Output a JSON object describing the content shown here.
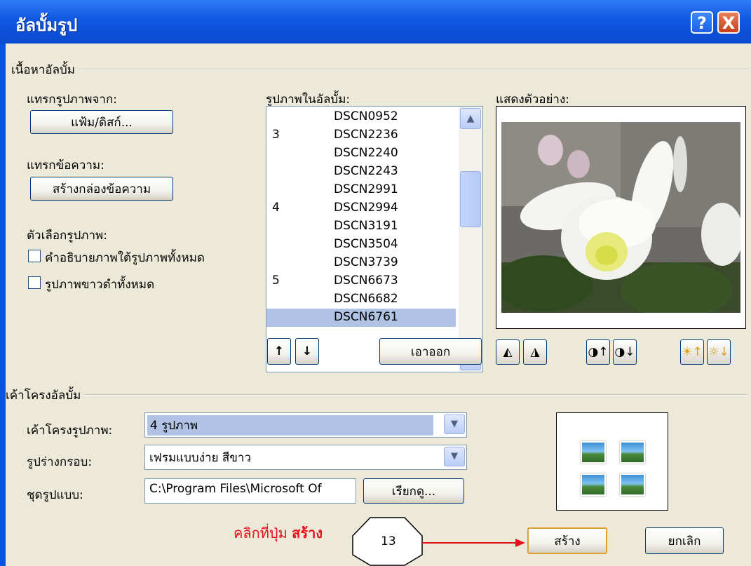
{
  "window": {
    "title": "อัลบั้มรูป",
    "help_label": "?",
    "close_label": "X"
  },
  "content_group": {
    "label": "เนื้อหาอัลบั้ม",
    "insert_from_label": "แทรกรูปภาพจาก:",
    "file_disk_button": "แฟ้ม/ดิสก์...",
    "insert_text_label": "แทรกข้อความ:",
    "new_textbox_button": "สร้างกล่องข้อความ",
    "picture_options_label": "ตัวเลือกรูปภาพ:",
    "caption_checkbox": "คำอธิบายภาพใต้รูปภาพทั้งหมด",
    "bw_checkbox": "รูปภาพขาวดำทั้งหมด"
  },
  "pictures_list": {
    "label": "รูปภาพในอัลบั้ม:",
    "items": [
      {
        "num": "",
        "name": "DSCN0952"
      },
      {
        "num": "3",
        "name": "DSCN2236"
      },
      {
        "num": "",
        "name": "DSCN2240"
      },
      {
        "num": "",
        "name": "DSCN2243"
      },
      {
        "num": "",
        "name": "DSCN2991"
      },
      {
        "num": "4",
        "name": "DSCN2994"
      },
      {
        "num": "",
        "name": "DSCN3191"
      },
      {
        "num": "",
        "name": "DSCN3504"
      },
      {
        "num": "",
        "name": "DSCN3739"
      },
      {
        "num": "5",
        "name": "DSCN6673"
      },
      {
        "num": "",
        "name": "DSCN6682"
      },
      {
        "num": "",
        "name": "DSCN6761"
      }
    ],
    "selected_index": 11,
    "move_up": "↑",
    "move_down": "↓",
    "remove_button": "เอาออก"
  },
  "preview": {
    "label": "แสดงตัวอย่าง:"
  },
  "layout_group": {
    "label": "เค้าโครงอัลบั้ม",
    "picture_layout_label": "เค้าโครงรูปภาพ:",
    "picture_layout_value": "4 รูปภาพ",
    "frame_shape_label": "รูปร่างกรอบ:",
    "frame_shape_value": "เฟรมแบบง่าย สีขาว",
    "theme_label": "ชุดรูปแบบ:",
    "theme_value": "C:\\Program Files\\Microsoft Of",
    "browse_button": "เรียกดู..."
  },
  "annotation": {
    "text_prefix": "คลิกที่ปุ่ม",
    "text_bold": "สร้าง",
    "step_number": "13"
  },
  "actions": {
    "create_button": "สร้าง",
    "cancel_button": "ยกเลิก"
  },
  "colors": {
    "titlebar": "#0b54e0",
    "dialog_bg": "#ece9d8",
    "selection": "#b0c3e4",
    "annotation_red": "#e8101a"
  }
}
